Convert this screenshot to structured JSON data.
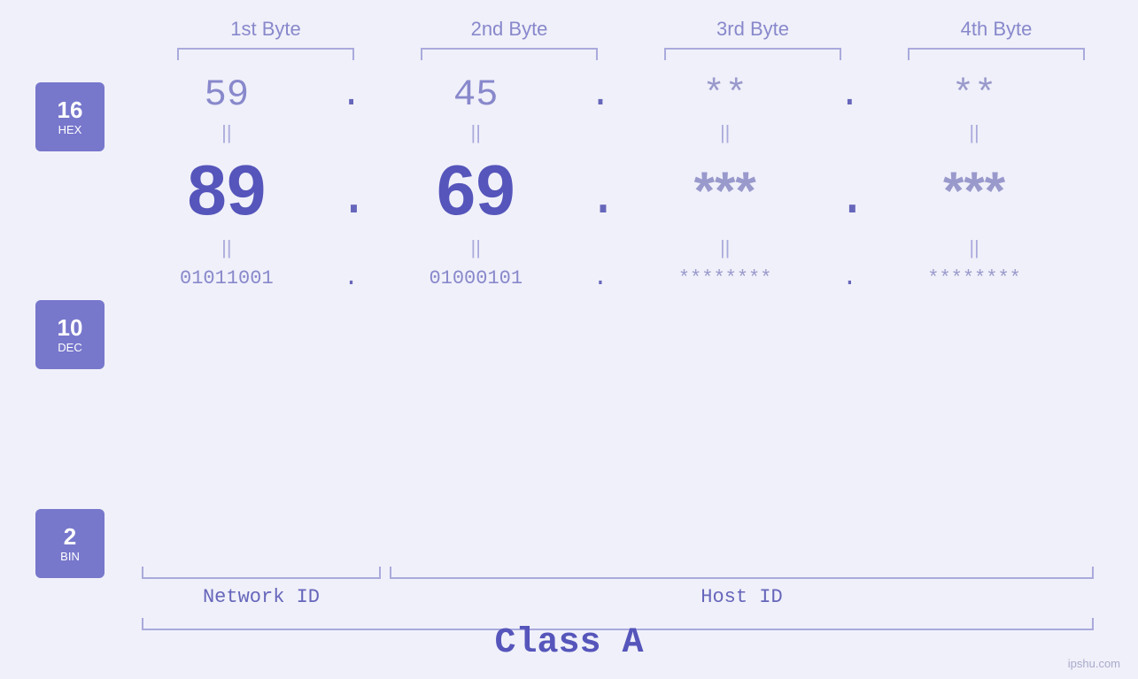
{
  "headers": {
    "byte1": "1st Byte",
    "byte2": "2nd Byte",
    "byte3": "3rd Byte",
    "byte4": "4th Byte"
  },
  "badges": {
    "hex": {
      "number": "16",
      "label": "HEX"
    },
    "dec": {
      "number": "10",
      "label": "DEC"
    },
    "bin": {
      "number": "2",
      "label": "BIN"
    }
  },
  "hex_row": {
    "b1": "59",
    "b2": "45",
    "b3": "**",
    "b4": "**"
  },
  "dec_row": {
    "b1": "89",
    "b2": "69",
    "b3": "***",
    "b4": "***"
  },
  "bin_row": {
    "b1": "01011001",
    "b2": "01000101",
    "b3": "********",
    "b4": "********"
  },
  "labels": {
    "network_id": "Network ID",
    "host_id": "Host ID",
    "class": "Class A"
  },
  "watermark": "ipshu.com"
}
